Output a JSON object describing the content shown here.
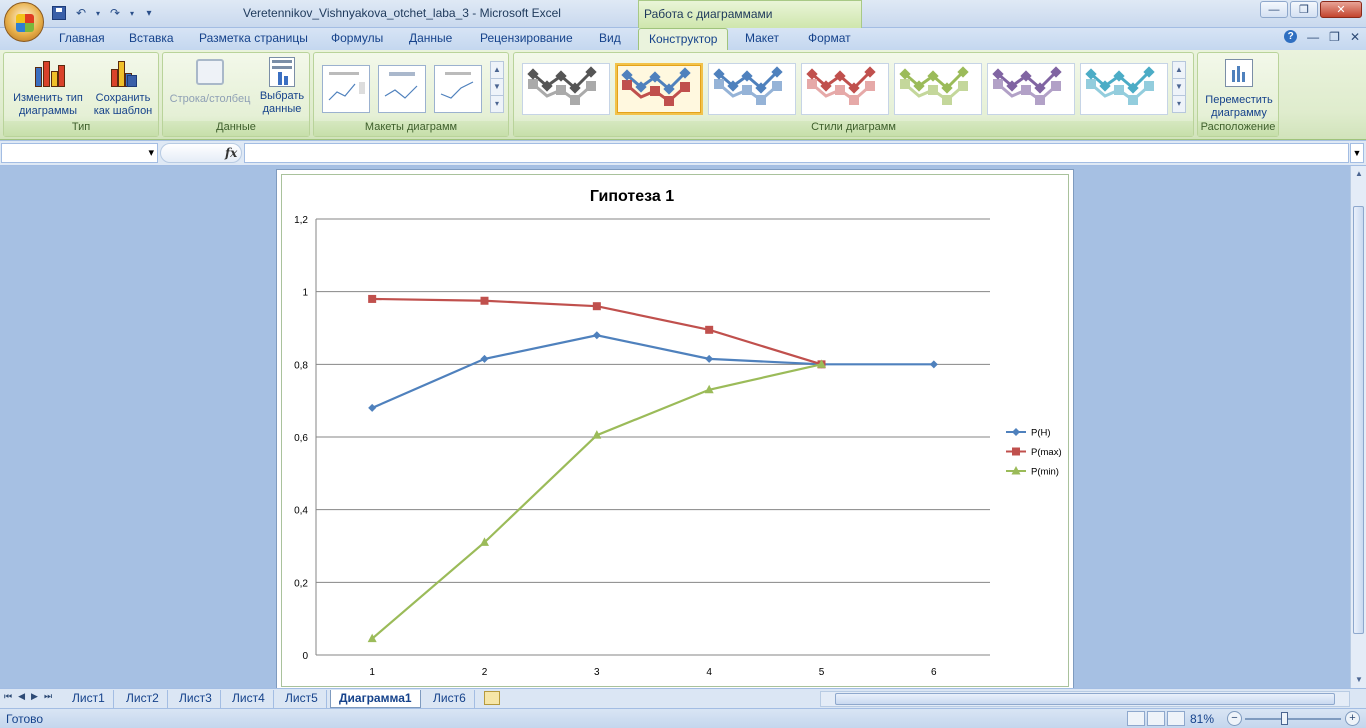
{
  "window": {
    "title": "Veretennikov_Vishnyakova_otchet_laba_3 - Microsoft Excel",
    "context_header": "Работа с диаграммами"
  },
  "tabs": [
    {
      "label": "Главная"
    },
    {
      "label": "Вставка"
    },
    {
      "label": "Разметка страницы"
    },
    {
      "label": "Формулы"
    },
    {
      "label": "Данные"
    },
    {
      "label": "Рецензирование"
    },
    {
      "label": "Вид"
    },
    {
      "label": "Конструктор"
    },
    {
      "label": "Макет"
    },
    {
      "label": "Формат"
    }
  ],
  "ribbon": {
    "type_group": {
      "label": "Тип",
      "change_type": "Изменить тип\nдиаграммы",
      "save_template": "Сохранить\nкак шаблон"
    },
    "data_group": {
      "label": "Данные",
      "row_col": "Строка/столбец",
      "select_data": "Выбрать\nданные"
    },
    "layouts_group": {
      "label": "Макеты диаграмм"
    },
    "styles_group": {
      "label": "Стили диаграмм"
    },
    "location_group": {
      "label": "Расположение",
      "move_chart": "Переместить\nдиаграмму"
    },
    "style_colors": [
      "#555555",
      "#4f81bd",
      "#4f81bd",
      "#c0504d",
      "#9bbb59",
      "#8064a2",
      "#4bacc6"
    ],
    "style_secondary": [
      "#aaaaaa",
      "#c0504d",
      "#95b3d7",
      "#e6a9a8",
      "#c4d79b",
      "#b2a1c7",
      "#93cddd"
    ]
  },
  "formula_bar": {
    "fx": "fx",
    "name_box": "",
    "formula": ""
  },
  "chart_data": {
    "type": "line",
    "title": "Гипотеза 1",
    "categories": [
      "1",
      "2",
      "3",
      "4",
      "5",
      "6"
    ],
    "ylim": [
      0,
      1.2
    ],
    "yticks": [
      "0",
      "0,2",
      "0,4",
      "0,6",
      "0,8",
      "1",
      "1,2"
    ],
    "grid": true,
    "legend_position": "right",
    "series": [
      {
        "name": "P(H)",
        "color": "#4f81bd",
        "marker": "diamond",
        "values": [
          0.68,
          0.815,
          0.88,
          0.815,
          0.8,
          0.8
        ]
      },
      {
        "name": "P(max)",
        "color": "#c0504d",
        "marker": "square",
        "values": [
          0.98,
          0.975,
          0.96,
          0.895,
          0.8,
          null
        ]
      },
      {
        "name": "P(min)",
        "color": "#9bbb59",
        "marker": "triangle",
        "values": [
          0.045,
          0.31,
          0.605,
          0.73,
          0.8,
          null
        ]
      }
    ]
  },
  "sheet_tabs": [
    {
      "label": "Лист1"
    },
    {
      "label": "Лист2"
    },
    {
      "label": "Лист3"
    },
    {
      "label": "Лист4"
    },
    {
      "label": "Лист5"
    },
    {
      "label": "Диаграмма1"
    },
    {
      "label": "Лист6"
    }
  ],
  "status": {
    "ready": "Готово",
    "zoom": "81%"
  }
}
